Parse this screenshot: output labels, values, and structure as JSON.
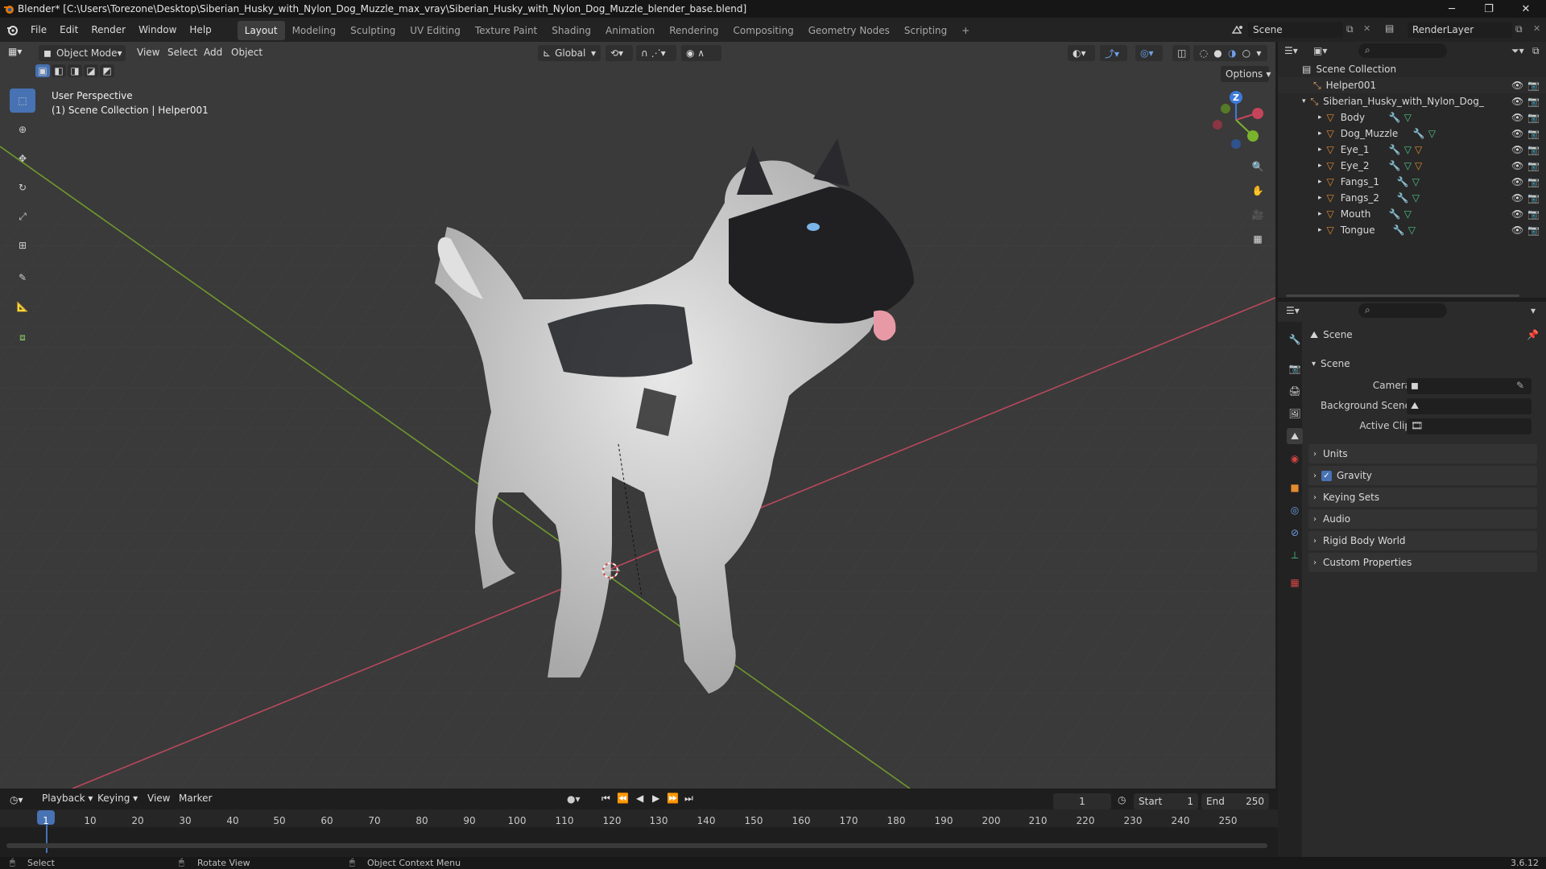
{
  "window": {
    "title": "Blender* [C:\\Users\\Torezone\\Desktop\\Siberian_Husky_with_Nylon_Dog_Muzzle_max_vray\\Siberian_Husky_with_Nylon_Dog_Muzzle_blender_base.blend]",
    "controls": {
      "minimize": "─",
      "maximize": "❐",
      "close": "✕"
    }
  },
  "menubar": {
    "menus": [
      "File",
      "Edit",
      "Render",
      "Window",
      "Help"
    ],
    "workspaces": [
      "Layout",
      "Modeling",
      "Sculpting",
      "UV Editing",
      "Texture Paint",
      "Shading",
      "Animation",
      "Rendering",
      "Compositing",
      "Geometry Nodes",
      "Scripting"
    ],
    "add_workspace": "+",
    "scene_name": "Scene",
    "view_layer": "RenderLayer"
  },
  "viewport": {
    "mode": "Object Mode",
    "menus": [
      "View",
      "Select",
      "Add",
      "Object"
    ],
    "transform_orientation": "Global",
    "options_label": "Options",
    "info_line1": "User Perspective",
    "info_line2": "(1) Scene Collection | Helper001",
    "gizmo_z": "Z",
    "background": "#3a3a3a",
    "x_axis_color": "#b8485c",
    "y_axis_color": "#6f9a2c"
  },
  "outliner": {
    "root": "Scene Collection",
    "items": [
      {
        "name": "Helper001",
        "icon": "empty-icon",
        "indent": 0
      },
      {
        "name": "Siberian_Husky_with_Nylon_Dog_Muzzle",
        "icon": "empty-icon",
        "indent": 0
      },
      {
        "name": "Body",
        "icon": "mesh-icon",
        "indent": 1
      },
      {
        "name": "Dog_Muzzle",
        "icon": "mesh-icon",
        "indent": 1
      },
      {
        "name": "Eye_1",
        "icon": "mesh-icon",
        "indent": 1
      },
      {
        "name": "Eye_2",
        "icon": "mesh-icon",
        "indent": 1
      },
      {
        "name": "Fangs_1",
        "icon": "mesh-icon",
        "indent": 1
      },
      {
        "name": "Fangs_2",
        "icon": "mesh-icon",
        "indent": 1
      },
      {
        "name": "Mouth",
        "icon": "mesh-icon",
        "indent": 1
      },
      {
        "name": "Tongue",
        "icon": "mesh-icon",
        "indent": 1
      }
    ]
  },
  "properties": {
    "context": "Scene",
    "panel": "Scene",
    "fields": [
      {
        "label": "Camera"
      },
      {
        "label": "Background Scene"
      },
      {
        "label": "Active Clip"
      }
    ],
    "sections": [
      "Units",
      "Gravity",
      "Keying Sets",
      "Audio",
      "Rigid Body World",
      "Custom Properties"
    ],
    "gravity_checked": true
  },
  "timeline": {
    "menus": [
      "Playback",
      "Keying",
      "View",
      "Marker"
    ],
    "current_frame": "1",
    "start_label": "Start",
    "start_value": "1",
    "end_label": "End",
    "end_value": "250",
    "ticks": [
      "1",
      "10",
      "20",
      "30",
      "40",
      "50",
      "60",
      "70",
      "80",
      "90",
      "100",
      "110",
      "120",
      "130",
      "140",
      "150",
      "160",
      "170",
      "180",
      "190",
      "200",
      "210",
      "220",
      "230",
      "240",
      "250"
    ]
  },
  "statusbar": {
    "select": "Select",
    "rotate": "Rotate View",
    "context_menu": "Object Context Menu",
    "version": "3.6.12"
  }
}
